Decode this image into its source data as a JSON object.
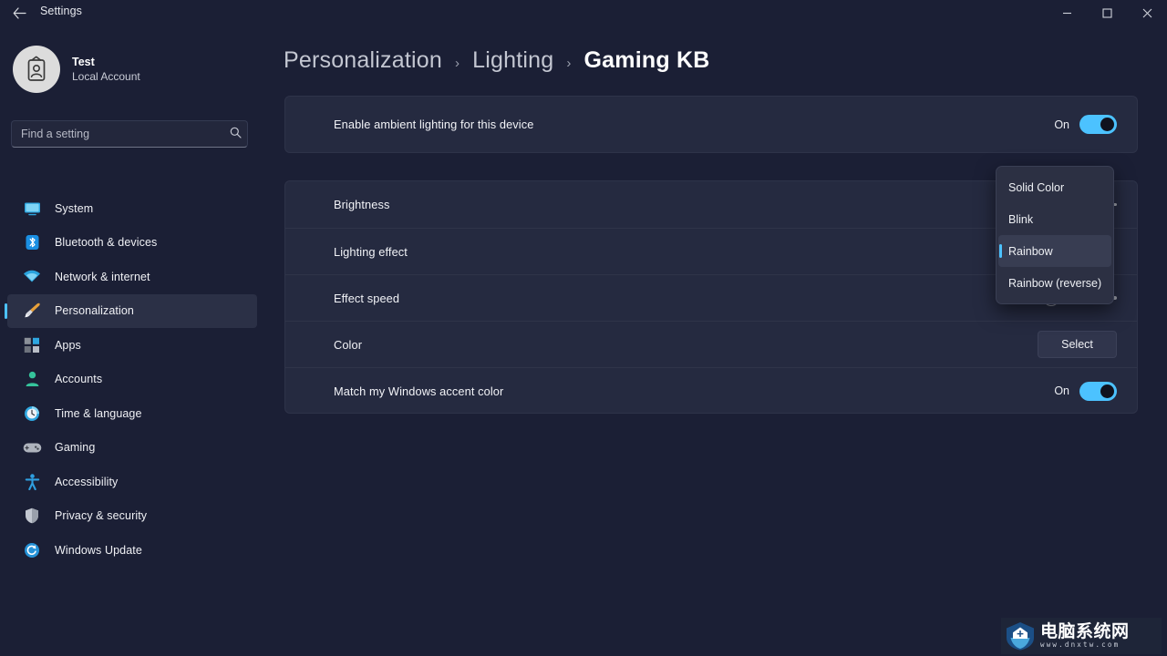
{
  "window": {
    "title": "Settings",
    "back_icon": "back-arrow-icon",
    "minimize_label": "—",
    "maximize_label": "☐",
    "close_label": "✕"
  },
  "sidebar": {
    "profile": {
      "name": "Test",
      "account_type": "Local Account",
      "avatar_icon": "account-badge-icon"
    },
    "search": {
      "placeholder": "Find a setting",
      "value": "",
      "icon": "search-icon"
    },
    "items": [
      {
        "label": "System",
        "icon": "system-monitor-icon",
        "active": false
      },
      {
        "label": "Bluetooth & devices",
        "icon": "bluetooth-icon",
        "active": false
      },
      {
        "label": "Network & internet",
        "icon": "wifi-icon",
        "active": false
      },
      {
        "label": "Personalization",
        "icon": "paintbrush-icon",
        "active": true
      },
      {
        "label": "Apps",
        "icon": "apps-icon",
        "active": false
      },
      {
        "label": "Accounts",
        "icon": "accounts-person-icon",
        "active": false
      },
      {
        "label": "Time & language",
        "icon": "clock-icon",
        "active": false
      },
      {
        "label": "Gaming",
        "icon": "gamepad-icon",
        "active": false
      },
      {
        "label": "Accessibility",
        "icon": "accessibility-person-icon",
        "active": false
      },
      {
        "label": "Privacy & security",
        "icon": "shield-icon",
        "active": false
      },
      {
        "label": "Windows Update",
        "icon": "update-refresh-icon",
        "active": false
      }
    ]
  },
  "breadcrumb": {
    "item1": "Personalization",
    "sep1": "›",
    "item2": "Lighting",
    "sep2": "›",
    "current": "Gaming KB"
  },
  "settings": {
    "ambient": {
      "label": "Enable ambient lighting for this device",
      "state_text": "On",
      "state": true
    },
    "brightness": {
      "label": "Brightness",
      "value": 76
    },
    "lighting_effect": {
      "label": "Lighting effect",
      "value": "Rainbow"
    },
    "effect_speed": {
      "label": "Effect speed",
      "value": 45
    },
    "color": {
      "label": "Color",
      "button_label": "Select"
    },
    "match_accent": {
      "label": "Match my Windows accent color",
      "state_text": "On",
      "state": true
    }
  },
  "dropdown": {
    "options": [
      {
        "label": "Solid Color",
        "selected": false
      },
      {
        "label": "Blink",
        "selected": false
      },
      {
        "label": "Rainbow",
        "selected": true
      },
      {
        "label": "Rainbow (reverse)",
        "selected": false
      }
    ]
  },
  "watermark": {
    "name": "电脑系统网",
    "url": "www.dnxtw.com"
  },
  "colors": {
    "accent": "#4cc2ff",
    "background": "#1b1f35",
    "card": "#252a40",
    "flyout": "#2c3043"
  }
}
